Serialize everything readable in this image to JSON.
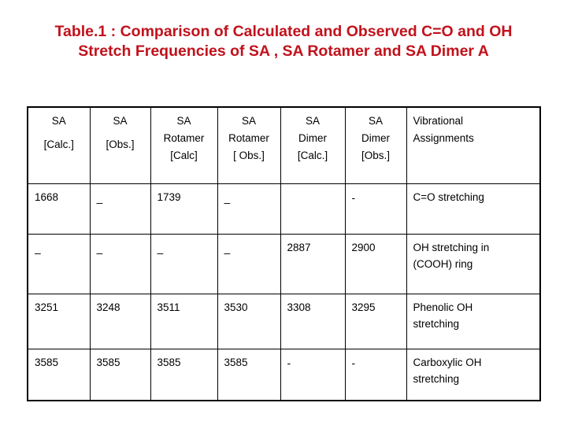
{
  "title": "Table.1 : Comparison of Calculated and Observed C=O and OH Stretch Frequencies of SA , SA Rotamer and SA Dimer A",
  "title_color": "#C1121C",
  "table": {
    "headers": [
      {
        "line1": "SA",
        "line2": "[Calc.]",
        "align": "center"
      },
      {
        "line1": "SA",
        "line2": "[Obs.]",
        "align": "center"
      },
      {
        "line1": "SA",
        "line1b": "Rotamer",
        "line2": "[Calc]",
        "align": "center"
      },
      {
        "line1": "SA",
        "line1b": "Rotamer",
        "line2": "[ Obs.]",
        "align": "center"
      },
      {
        "line1": "SA",
        "line1b": "Dimer",
        "line2": "[Calc.]",
        "align": "center"
      },
      {
        "line1": "SA",
        "line1b": "Dimer",
        "line2": "[Obs.]",
        "align": "center"
      },
      {
        "line1": "Vibrational",
        "line1b": "Assignments",
        "line2": "",
        "align": "left"
      }
    ],
    "rows": [
      {
        "sa_calc": "1668",
        "sa_obs": "–",
        "rot_calc": "1739",
        "rot_obs": "–",
        "dim_calc": "",
        "dim_obs": "-",
        "assignment_l1": "C=O stretching",
        "assignment_l2": ""
      },
      {
        "sa_calc": "–",
        "sa_obs": "–",
        "rot_calc": "–",
        "rot_obs": "–",
        "dim_calc": "2887",
        "dim_obs": "2900",
        "assignment_l1": "OH stretching in",
        "assignment_l2": "(COOH) ring"
      },
      {
        "sa_calc": "3251",
        "sa_obs": "3248",
        "rot_calc": "3511",
        "rot_obs": "3530",
        "dim_calc": "3308",
        "dim_obs": "3295",
        "assignment_l1": "Phenolic OH",
        "assignment_l2": "stretching"
      },
      {
        "sa_calc": "3585",
        "sa_obs": "3585",
        "rot_calc": "3585",
        "rot_obs": "3585",
        "dim_calc": "-",
        "dim_obs": "-",
        "assignment_l1": "Carboxylic OH",
        "assignment_l2": "stretching"
      }
    ]
  }
}
